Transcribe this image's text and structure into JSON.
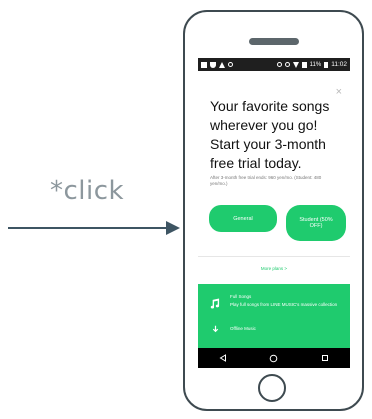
{
  "annotation": {
    "click_label": "*click"
  },
  "status_bar": {
    "left_icons": [
      "notification-icon",
      "shield-icon",
      "warning-icon",
      "sync-icon"
    ],
    "right_text": "11%",
    "time": "11:02"
  },
  "dialog": {
    "close_label": "×",
    "headline": "Your favorite songs wherever you go! Start your 3-month free trial today.",
    "fine_print": "After 3-month free trial ends: 960 yen/mo. (Student: 480 yen/mo.)",
    "buttons": {
      "general": "General",
      "student": "Student (50% OFF)"
    },
    "more_plans": "More plans >"
  },
  "features": [
    {
      "icon": "music-note-icon",
      "title": "Full Songs",
      "description": "Play full songs from LINE MUSIC's massive collection"
    },
    {
      "icon": "download-icon",
      "title": "Offline Music",
      "description": ""
    }
  ],
  "navbar": {
    "icons": [
      "back-icon",
      "home-icon",
      "recents-icon"
    ]
  },
  "colors": {
    "accent": "#1fcb6e",
    "arrow": "#3e5563",
    "phone_frame": "#3e4a50"
  }
}
